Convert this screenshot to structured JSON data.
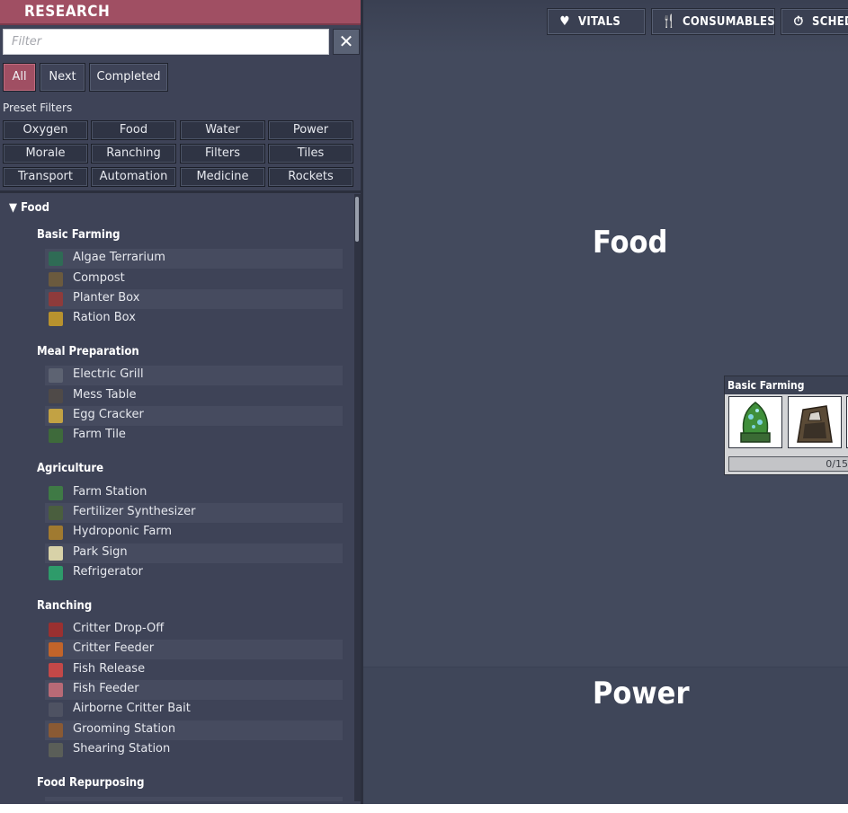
{
  "panel": {
    "title": "RESEARCH",
    "filter_placeholder": "Filter",
    "clear_icon": "close-icon",
    "tabs": [
      {
        "label": "All",
        "selected": true
      },
      {
        "label": "Next",
        "selected": false
      },
      {
        "label": "Completed",
        "selected": false
      }
    ],
    "preset_label": "Preset Filters",
    "presets": [
      "Oxygen",
      "Food",
      "Water",
      "Power",
      "Morale",
      "Ranching",
      "Filters",
      "Tiles",
      "Transport",
      "Automation",
      "Medicine",
      "Rockets"
    ]
  },
  "tree": {
    "category": "Food",
    "groups": [
      {
        "name": "Basic Farming",
        "items": [
          "Algae Terrarium",
          "Compost",
          "Planter Box",
          "Ration Box"
        ]
      },
      {
        "name": "Meal Preparation",
        "items": [
          "Electric Grill",
          "Mess Table",
          "Egg Cracker",
          "Farm Tile"
        ]
      },
      {
        "name": "Agriculture",
        "items": [
          "Farm Station",
          "Fertilizer Synthesizer",
          "Hydroponic Farm",
          "Park Sign",
          "Refrigerator"
        ]
      },
      {
        "name": "Ranching",
        "items": [
          "Critter Drop-Off",
          "Critter Feeder",
          "Fish Release",
          "Fish Feeder",
          "Airborne Critter Bait",
          "Grooming Station",
          "Shearing Station"
        ]
      },
      {
        "name": "Food Repurposing",
        "items": []
      }
    ]
  },
  "canvas": {
    "top_buttons": [
      {
        "label": "VITALS",
        "icon": "heart-icon"
      },
      {
        "label": "CONSUMABLES",
        "icon": "fork-knife-icon"
      },
      {
        "label": "SCHED",
        "icon": "stopwatch-icon"
      }
    ],
    "section_titles": [
      "Food",
      "Power"
    ],
    "node": {
      "title": "Basic Farming",
      "progress": "0/15",
      "progress_fraction": 0
    }
  },
  "colors": {
    "header_accent": "#a04f63",
    "panel_bg": "#3e4357",
    "canvas_bg": "#434a5d"
  }
}
